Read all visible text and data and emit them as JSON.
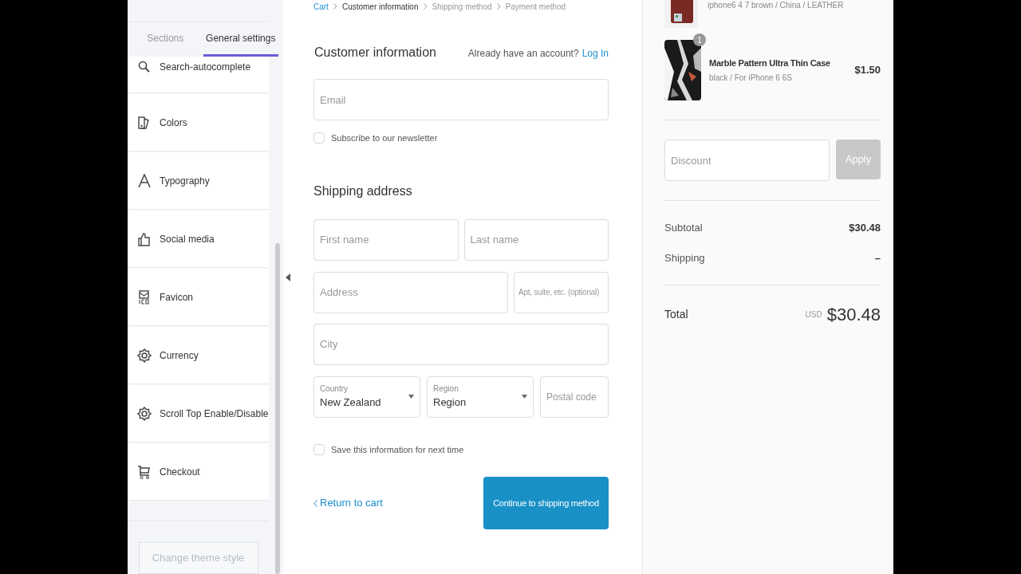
{
  "sidebar": {
    "tabs": [
      {
        "label": "Sections",
        "selected": false
      },
      {
        "label": "General settings",
        "selected": true
      }
    ],
    "items": [
      {
        "label": "Search-autocomplete",
        "kind": "search"
      },
      {
        "label": "Colors",
        "kind": "colors"
      },
      {
        "label": "Typography",
        "kind": "type"
      },
      {
        "label": "Social media",
        "kind": "thumb"
      },
      {
        "label": "Favicon",
        "kind": "favicon"
      },
      {
        "label": "Currency",
        "kind": "gear"
      },
      {
        "label": "Scroll Top Enable/Disable",
        "kind": "gear"
      },
      {
        "label": "Checkout",
        "kind": "cart"
      }
    ],
    "footer_button": "Change theme style"
  },
  "breadcrumb": [
    {
      "label": "Cart",
      "kind": "link"
    },
    {
      "label": "Customer information",
      "kind": "current"
    },
    {
      "label": "Shipping method",
      "kind": "future"
    },
    {
      "label": "Payment method",
      "kind": "future"
    }
  ],
  "customer": {
    "title": "Customer information",
    "account_prompt": "Already have an account?",
    "login_link": "Log In",
    "email": {
      "placeholder": "Email"
    },
    "newsletter": {
      "label": "Subscribe to our newsletter",
      "checked": false
    }
  },
  "shipping": {
    "title": "Shipping address",
    "first_name": {
      "placeholder": "First name"
    },
    "last_name": {
      "placeholder": "Last name"
    },
    "address": {
      "placeholder": "Address"
    },
    "apartment": {
      "placeholder": "Apt, suite, etc. (optional)"
    },
    "city": {
      "placeholder": "City"
    },
    "country": {
      "label": "Country",
      "value": "New Zealand"
    },
    "region": {
      "label": "Region",
      "value": "Region"
    },
    "postal_code": {
      "placeholder": "Postal code"
    },
    "save_info": {
      "label": "Save this information for next time",
      "checked": false
    }
  },
  "return_link": "Return to cart",
  "continue_button": "Continue to shipping method",
  "order": {
    "items": [
      {
        "variant": "iphone6 4 7 brown / China / LEATHER",
        "kind": "cut"
      },
      {
        "name": "Marble Pattern Ultra Thin Case",
        "variant": "black / For iPhone 6 6S",
        "price": "$1.50",
        "quantity": "1",
        "kind": "full"
      }
    ],
    "discount": {
      "placeholder": "Discount"
    },
    "apply_button": "Apply",
    "subtotal_label": "Subtotal",
    "subtotal": "$30.48",
    "shipping_label": "Shipping",
    "shipping": "–",
    "total_label": "Total",
    "currency": "USD",
    "total": "$30.48"
  }
}
